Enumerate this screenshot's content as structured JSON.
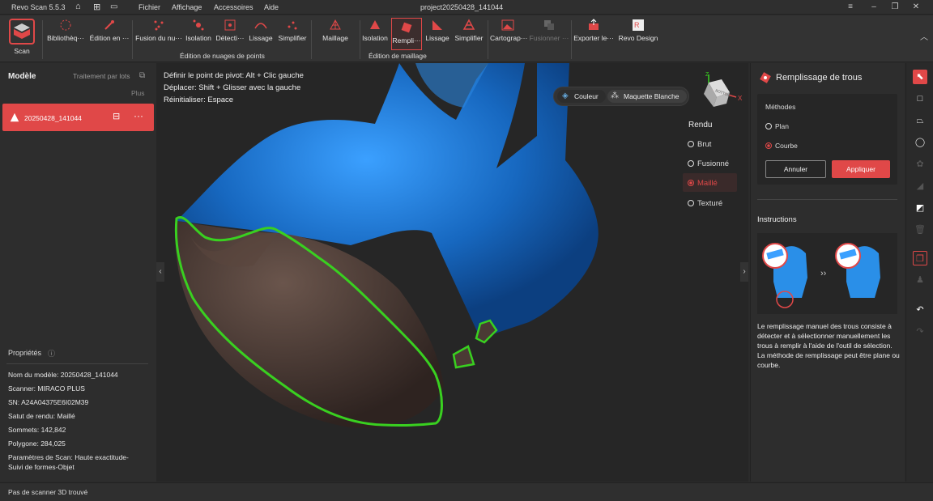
{
  "app": {
    "title": "Revo Scan 5.5.3",
    "project": "project20250428_141044"
  },
  "menu": [
    "Fichier",
    "Affichage",
    "Accessoires",
    "Aide"
  ],
  "toolbar": {
    "scan": "Scan",
    "items1": [
      "Bibliothèq···",
      "Édition en ···"
    ],
    "items2": [
      "Fusion du nu···",
      "Isolation",
      "Détecti···",
      "Lissage",
      "Simplifier"
    ],
    "items3": [
      "Maillage",
      "Isolation",
      "Rempli···",
      "Lissage",
      "Simplifier"
    ],
    "items4": [
      "Cartograp···",
      "Fusionner ···",
      "Exporter le···",
      "Revo Design"
    ],
    "group_points": "Édition de nuages de points",
    "group_mesh": "Édition de maillage"
  },
  "left": {
    "title": "Modèle",
    "batch": "Traitement par lots",
    "more": "Plus",
    "model_name": "20250428_141044"
  },
  "properties": {
    "title": "Propriétés",
    "rows": [
      {
        "label": "Nom du modèle:",
        "value": "20250428_141044"
      },
      {
        "label": "Scanner:",
        "value": "MIRACO PLUS"
      },
      {
        "label": "SN:",
        "value": "A24A04375E6I02M39"
      },
      {
        "label": "Satut de rendu:",
        "value": "Maillé"
      },
      {
        "label": "Sommets:",
        "value": "142,842"
      },
      {
        "label": "Polygone:",
        "value": "284,025"
      },
      {
        "label": "Paramètres de Scan:",
        "value": "Haute exactitude-"
      }
    ],
    "extra": "Suivi de formes-Objet"
  },
  "viewport": {
    "hint1": "Définir le point de pivot: Alt + Clic gauche",
    "hint2": "Déplacer: Shift + Glisser avec la gauche",
    "hint3": "Réinitialiser: Espace",
    "color_btn": "Couleur",
    "white_btn": "Maquette Blanche",
    "render_title": "Rendu",
    "render": [
      "Brut",
      "Fusionné",
      "Maillé",
      "Texturé"
    ],
    "render_selected": "Maillé",
    "axis": {
      "x": "X",
      "z": "Z",
      "cube": "BOTTOM"
    }
  },
  "right": {
    "title": "Remplissage de trous",
    "methods": "Méthodes",
    "plan": "Plan",
    "courbe": "Courbe",
    "cancel": "Annuler",
    "apply": "Appliquer",
    "instructions": "Instructions",
    "desc": "Le remplissage manuel des trous consiste à détecter et à sélectionner manuellement les trous à remplir à l'aide de l'outil de sélection. La méthode de remplissage peut être plane ou courbe."
  },
  "status": "Pas de scanner 3D trouvé",
  "colors": {
    "accent": "#e04848",
    "mesh": "#1f6fbf",
    "hole": "#4a3a34",
    "outline": "#39d020"
  }
}
